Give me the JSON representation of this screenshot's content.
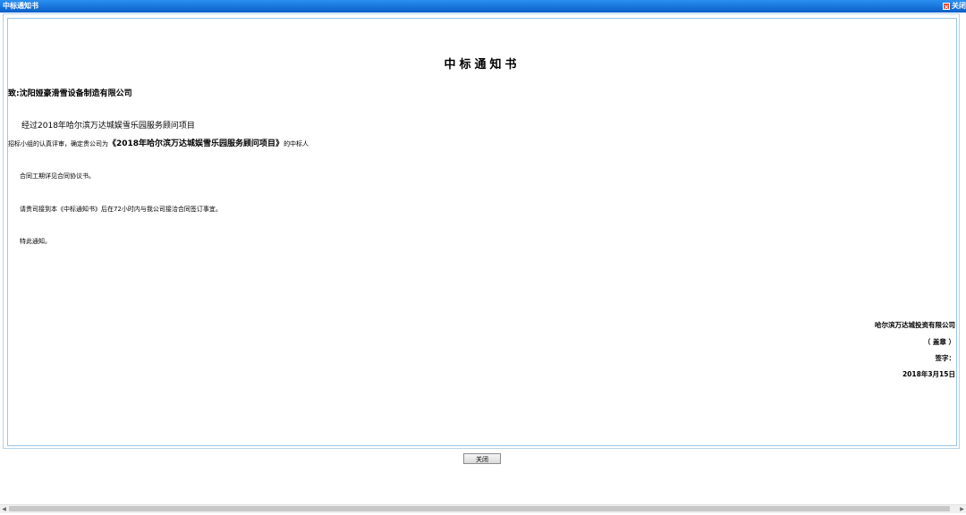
{
  "window": {
    "title": "中标通知书",
    "close_label": "关闭"
  },
  "letter": {
    "title": "中标通知书",
    "recipient": "致:沈阳娅豪滑雪设备制造有限公司",
    "para1_prefix": "经过",
    "para1_project": "2018年哈尔滨万达城娱雪乐园服务顾问项目",
    "para1b_prefix": "招标小组的认真评审，确定贵公司为",
    "para1b_project": "《2018年哈尔滨万达城娱雪乐园服务顾问项目》",
    "para1b_suffix": "的中标人",
    "para2": "合同工期详见合同协议书。",
    "para3": "请贵司接到本《中标通知书》后在72小时内与我公司接洽合同签订事宜。",
    "para4": "特此通知。",
    "company": "哈尔滨万达城投资有限公司",
    "seal": "（ 盖章 ）",
    "signature_label": "签字：",
    "date": "2018年3月15日"
  },
  "footer": {
    "close_button": "关闭"
  }
}
